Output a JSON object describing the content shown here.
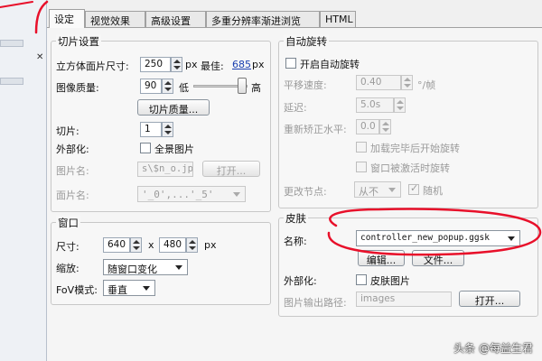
{
  "tabs": [
    {
      "label": "设定",
      "active": true
    },
    {
      "label": "视觉效果",
      "active": false
    },
    {
      "label": "高级设置",
      "active": false
    },
    {
      "label": "多重分辨率渐进浏览",
      "active": false
    },
    {
      "label": "HTML",
      "active": false
    }
  ],
  "slice_settings": {
    "title": "切片设置",
    "cube_face_size_label": "立方体面片尺寸:",
    "cube_face_size_value": "250",
    "cube_face_size_unit": "px",
    "best_label": "最佳:",
    "best_value": "685",
    "best_unit": "px",
    "image_quality_label": "图像质量:",
    "image_quality_value": "90",
    "quality_low": "低",
    "quality_high": "高",
    "quality_slider_percent": 90,
    "slice_quality_button": "切片质量...",
    "slices_label": "切片:",
    "slices_value": "1",
    "externalize_label": "外部化:",
    "panorama_image_label": "全景图片",
    "image_name_label": "图片名:",
    "image_name_value": "s\\$n_o.jpg",
    "open_button": "打开...",
    "face_name_label": "面片名:",
    "face_name_value": "'_0',...'_5'"
  },
  "window": {
    "title": "窗口",
    "size_label": "尺寸:",
    "width_value": "640",
    "x_label": "x",
    "height_value": "480",
    "unit": "px",
    "scale_label": "缩放:",
    "scale_value": "随窗口变化",
    "fov_label": "FoV模式:",
    "fov_value": "垂直"
  },
  "auto_rotate": {
    "title": "自动旋转",
    "enable_label": "开启自动旋转",
    "speed_label": "平移速度:",
    "speed_value": "0.40",
    "speed_unit": "°/帧",
    "delay_label": "延迟:",
    "delay_value": "5.0s",
    "horizon_label": "重新矫正水平:",
    "horizon_value": "0.0",
    "start_after_load_label": "加载完毕后开始旋转",
    "rotate_when_active_label": "窗口被激活时旋转",
    "change_node_label": "更改节点:",
    "change_node_value": "从不",
    "random_label": "随机"
  },
  "skin": {
    "title": "皮肤",
    "name_label": "名称:",
    "name_value": "controller_new_popup.ggsk",
    "edit_button": "编辑...",
    "file_button": "文件...",
    "externalize_label": "外部化:",
    "skin_image_label": "皮肤图片",
    "output_path_label": "图片输出路径:",
    "output_path_value": "images",
    "open_button": "打开..."
  },
  "watermark": "头条 @每益生君",
  "colors": {
    "annotation_red": "#e8102a",
    "link_blue": "#1a3fb0"
  }
}
